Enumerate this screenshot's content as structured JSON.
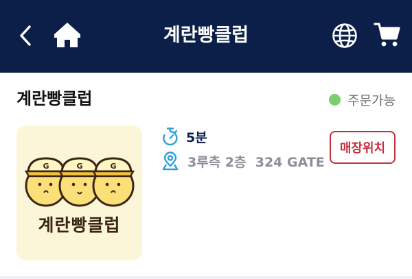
{
  "header": {
    "title": "계란빵클럽",
    "back_icon": "chevron-left-icon",
    "home_icon": "home-icon",
    "language_icon": "globe-icon",
    "cart_icon": "cart-icon",
    "background_color": "#0c1f48"
  },
  "store": {
    "name": "계란빵클럽",
    "status_text": "주문가능",
    "status_color": "#7ccd6f",
    "logo_wordmark": "계란빵클럽",
    "wait_time": "5분",
    "location": "3루측 2층  324 GATE",
    "map_button_label": "매장위치",
    "map_button_color": "#c4303f",
    "timer_icon": "stopwatch-icon",
    "location_icon": "map-pin-icon"
  }
}
